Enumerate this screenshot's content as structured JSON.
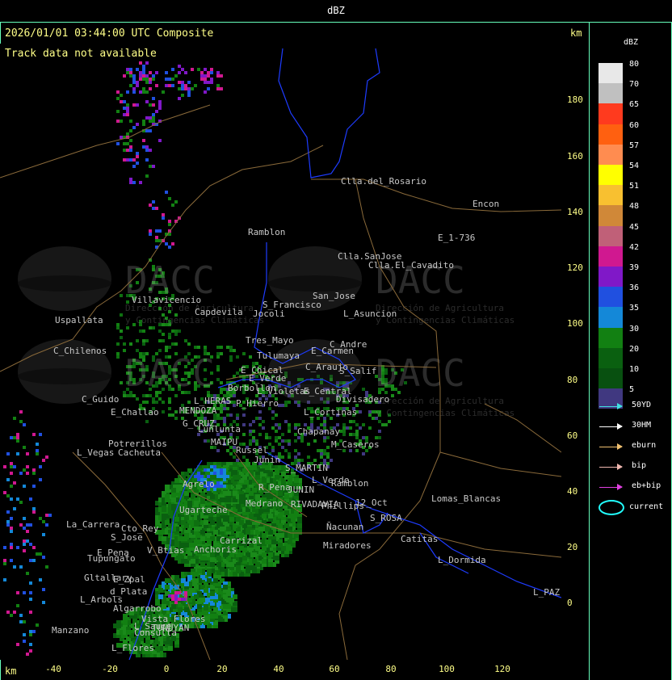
{
  "header": {
    "title": "dBZ"
  },
  "map": {
    "title": "2026/01/01 03:44:00 UTC Composite",
    "status": "Track data not available",
    "km_label": "km",
    "y_ticks": [
      "180",
      "160",
      "140",
      "120",
      "100",
      "80",
      "60",
      "40",
      "20",
      "0"
    ],
    "x_ticks": [
      "-40",
      "-20",
      "0",
      "20",
      "40",
      "60",
      "80",
      "100",
      "120"
    ],
    "watermark": {
      "brand": "DACC",
      "line1": "Dirección de Agricultura",
      "line2": "y Contingencias Climáticas"
    },
    "places": [
      "Clla.del_Rosario",
      "Encon",
      "E_1-736",
      "Ramblon",
      "Clla.SanJose",
      "Clla.El_Cavadito",
      "Villavicencio",
      "Capdevila",
      "S_Francisco",
      "San_Jose",
      "L_Asuncion",
      "Uspallata",
      "Jocoli",
      "Tres_Mayo",
      "C_Andre",
      "C_Chilenos",
      "Tulumaya",
      "E_Carmen",
      "E_Chical",
      "C_Araujo",
      "E_Verde",
      "S_Salif",
      "Borbollon",
      "L_Violetas",
      "E_Central",
      "Divisadero",
      "C_Guido",
      "L_HERAS",
      "P_Hierro",
      "L_Cortinas",
      "E_Challao",
      "MENDOZA",
      "G_CRUZ",
      "Chapanay",
      "Lunlunta",
      "M_Caseros",
      "Potrerillos",
      "MAIPU",
      "Russel",
      "L_Vegas",
      "Cacheuta",
      "S_MARTIN",
      "Junin",
      "Agrelo",
      "Medrano",
      "R_Pena",
      "JUNIN",
      "L_Verde",
      "Ramblon",
      "Ugarteche",
      "RIVADAVIA",
      "Phillips",
      "12_Oct",
      "Lomas_Blancas",
      "La_Carrera",
      "Cto_Rey",
      "S_Jose",
      "Carrizal",
      "Tupungato",
      "Anchoris",
      "E_Pena",
      "V_Btias",
      "S_ROSA",
      "Catitas",
      "Ñacunan",
      "Miradores",
      "L_Dormida",
      "Gltallary",
      "E_Zpal",
      "L_Arbols",
      "d_Plata",
      "Algarrobo",
      "Vista_Flores",
      "L_Sauce",
      "L_PAZ",
      "Manzano",
      "TUNUYAN",
      "L_Flores",
      "Consulta"
    ]
  },
  "legend": {
    "unit": "dBZ",
    "levels": [
      {
        "label": "80",
        "color": "#e8e8e8"
      },
      {
        "label": "70",
        "color": "#c0c0c0"
      },
      {
        "label": "65",
        "color": "#ff3a1e"
      },
      {
        "label": "60",
        "color": "#ff6010"
      },
      {
        "label": "57",
        "color": "#ff8c50"
      },
      {
        "label": "54",
        "color": "#ffff00"
      },
      {
        "label": "51",
        "color": "#f8c030"
      },
      {
        "label": "48",
        "color": "#d08838"
      },
      {
        "label": "45",
        "color": "#c06078"
      },
      {
        "label": "42",
        "color": "#d01890"
      },
      {
        "label": "39",
        "color": "#8018c8"
      },
      {
        "label": "36",
        "color": "#2050e0"
      },
      {
        "label": "35",
        "color": "#1488d8"
      },
      {
        "label": "30",
        "color": "#128012"
      },
      {
        "label": "20",
        "color": "#0a6010"
      },
      {
        "label": "10",
        "color": "#085010"
      },
      {
        "label": "5",
        "color": "#403880"
      }
    ],
    "tracks": [
      {
        "label": "50YD",
        "color": "#40e0e0"
      },
      {
        "label": "30HM",
        "color": "#ffffff"
      },
      {
        "label": "eburn",
        "color": "#f0c070"
      },
      {
        "label": "bip",
        "color": "#f0b8b0"
      },
      {
        "label": "eb+bip",
        "color": "#e040e0"
      }
    ],
    "current_label": "current"
  }
}
